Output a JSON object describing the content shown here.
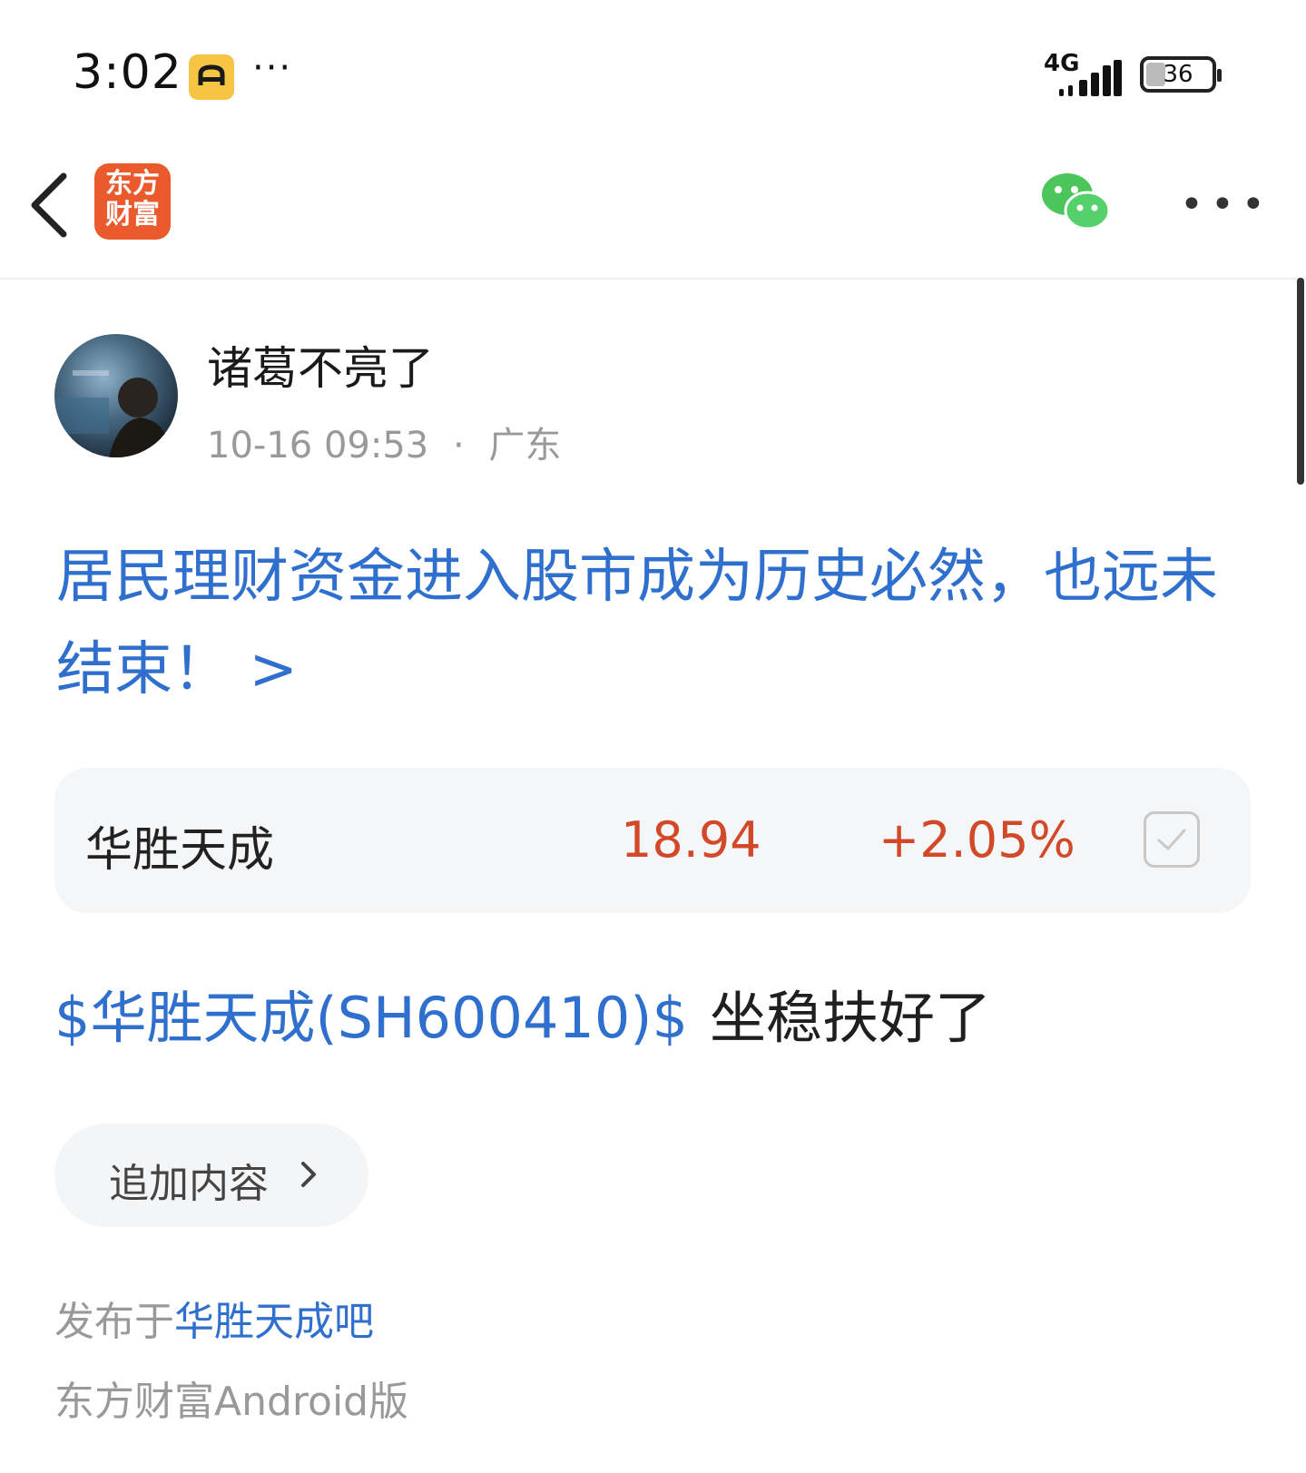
{
  "status_bar": {
    "time": "3:02",
    "app_icon": "car-app-icon",
    "more": "···",
    "network": "4G",
    "battery": "36",
    "battery_level": 0.36
  },
  "nav": {
    "back_icon": "chevron-left-icon",
    "logo_line1": "东方",
    "logo_line2": "财富",
    "share_icon": "wechat-icon",
    "more": "•••"
  },
  "post": {
    "author": "诸葛不亮了",
    "time": "10-16 09:53",
    "location": "广东",
    "meta_separator": "·",
    "title": "居民理财资金进入股市成为历史必然，也远未结束！ >",
    "stock": {
      "name": "华胜天成",
      "price": "18.94",
      "change": "+2.05%"
    },
    "body_link": "$华胜天成(SH600410)$",
    "body_text": "坐稳扶好了",
    "append_label": "追加内容",
    "published_prefix": "发布于",
    "forum": "华胜天成吧",
    "client": "东方财富Android版"
  },
  "colors": {
    "link": "#2f6fce",
    "price_up": "#d2492a",
    "brand": "#ea5a2c",
    "wechat": "#4cc65a"
  }
}
